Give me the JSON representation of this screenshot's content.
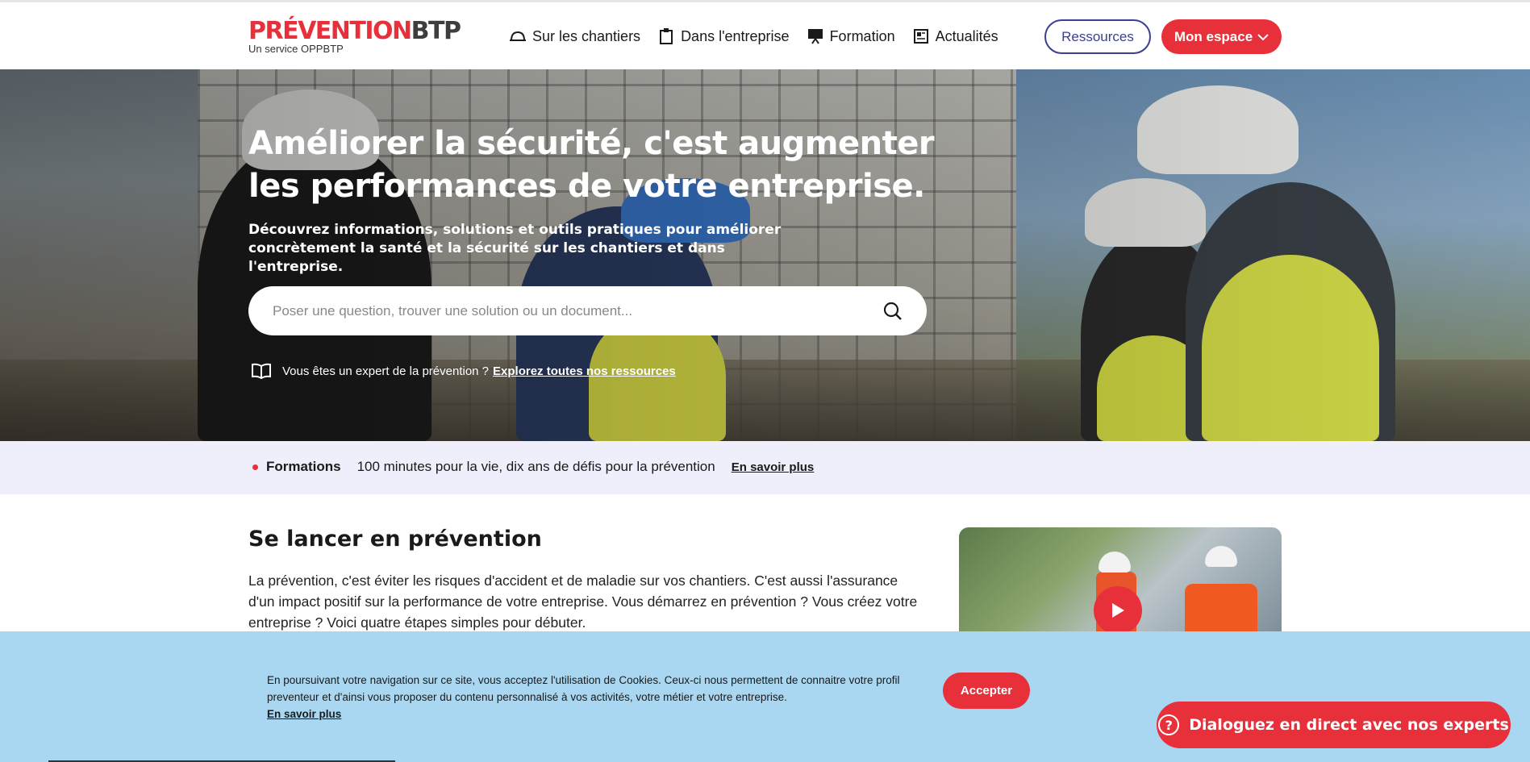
{
  "header": {
    "logo": {
      "word_red": "PRÉVENTION",
      "word_dark": "BTP",
      "subtitle": "Un service OPPBTP"
    },
    "nav": [
      {
        "label": "Sur les chantiers",
        "icon": "helmet-icon"
      },
      {
        "label": "Dans l'entreprise",
        "icon": "clipboard-icon"
      },
      {
        "label": "Formation",
        "icon": "presentation-icon"
      },
      {
        "label": "Actualités",
        "icon": "newspaper-icon"
      }
    ],
    "resources_label": "Ressources",
    "space_label": "Mon espace"
  },
  "hero": {
    "title": "Améliorer la sécurité, c'est augmenter les performances de votre entreprise.",
    "subtitle": "Découvrez informations, solutions et outils pratiques pour améliorer concrètement la santé et la sécurité sur les chantiers et dans l'entreprise.",
    "search_placeholder": "Poser une question, trouver une solution ou un document...",
    "expert_text": "Vous êtes un expert de la prévention ?",
    "expert_link": "Explorez toutes nos ressources"
  },
  "band": {
    "tag": "Formations",
    "text": "100 minutes pour la vie, dix ans de défis pour la prévention",
    "link": "En savoir plus"
  },
  "content": {
    "title": "Se lancer en prévention",
    "text": "La prévention, c'est éviter les risques d'accident et de maladie sur vos chantiers. C'est aussi l'assurance d'un impact positif sur la performance de votre entreprise. Vous démarrez en prévention ? Vous créez votre entreprise ? Voici quatre étapes simples pour débuter."
  },
  "cookie": {
    "text": "En poursuivant votre navigation sur ce site, vous acceptez l'utilisation de Cookies. Ceux-ci nous permettent de connaitre votre profil preventeur et d'ainsi vous proposer du contenu personnalisé à vos activités, votre métier et votre entreprise.",
    "link": "En savoir plus",
    "accept_label": "Accepter"
  },
  "chat": {
    "label": "Dialoguez en direct avec nos experts"
  },
  "colors": {
    "brand_red": "#e8303b",
    "brand_blue": "#3c3f8f",
    "band_bg": "#eeeffa",
    "cookie_bg": "#a9d7f2"
  }
}
